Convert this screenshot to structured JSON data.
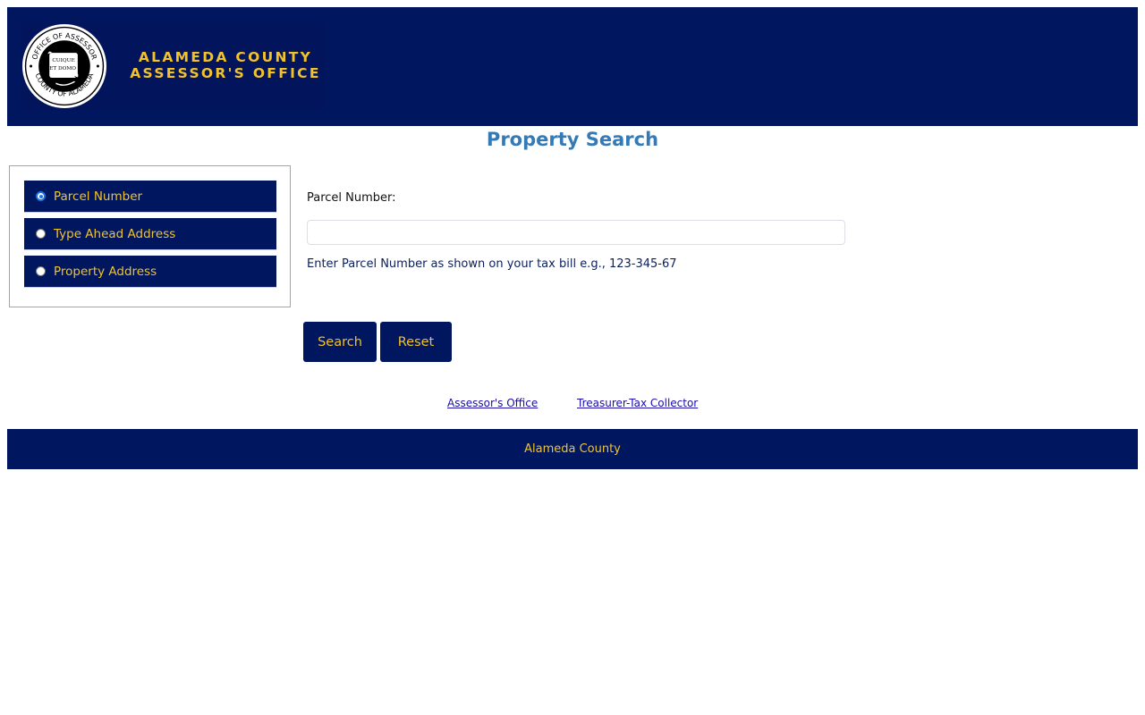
{
  "header": {
    "logo_line_1": "ALAMEDA COUNTY",
    "logo_line_2": "ASSESSOR'S OFFICE",
    "seal_top_text": "OFFICE OF ASSESSOR",
    "seal_bottom_text": "COUNTY OF ALAMEDA",
    "seal_scroll_text_1": "CUIQUE",
    "seal_scroll_text_2": "ET DOMO",
    "seal_icon": "county-seal-icon"
  },
  "page_title": "Property Search",
  "search_options": [
    {
      "label": "Parcel Number",
      "selected": true
    },
    {
      "label": "Type Ahead Address",
      "selected": false
    },
    {
      "label": "Property Address",
      "selected": false
    }
  ],
  "form": {
    "field_label": "Parcel Number:",
    "input_value": "",
    "input_placeholder": "",
    "help_text": "Enter Parcel Number as shown on your tax bill e.g., 123-345-67"
  },
  "buttons": {
    "search": "Search",
    "reset": "Reset"
  },
  "links": {
    "assessor": "Assessor's Office",
    "treasurer": "Treasurer-Tax Collector"
  },
  "footer": {
    "text": "Alameda County"
  },
  "colors": {
    "brand_navy": "#00175f",
    "accent_gold": "#f2c22b",
    "title_blue": "#337ab7",
    "link_blue": "#1a0dab"
  }
}
